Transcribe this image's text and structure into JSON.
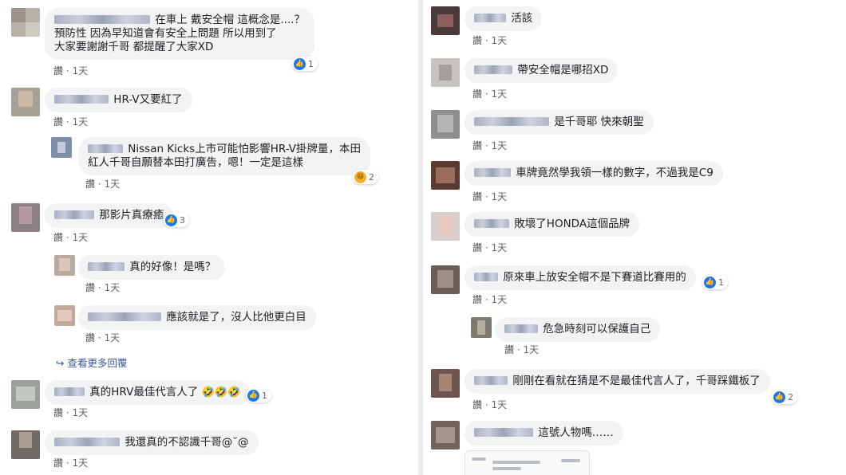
{
  "like_label": "讚",
  "dot": "·",
  "time": "1天",
  "left": [
    {
      "text1": "在車上 戴安全帽 這概念是....？",
      "text2": "預防性 因為早知道會有安全上問題 所以用到了",
      "text3": "大家要謝謝千哥 都提醒了大家XD",
      "reaction_count": "1"
    },
    {
      "text1": "HR-V又要紅了"
    },
    {
      "text1": "Nissan Kicks上市可能怕影響HR-V掛牌量，本田",
      "text2": "紅人千哥自願替本田打廣告，嗯！一定是這樣",
      "reaction_count": "2"
    },
    {
      "text1": "那影片真療癒",
      "reaction_count": "3"
    },
    {
      "text1": "真的好像！是嗎？"
    },
    {
      "text1": "應該就是了，沒人比他更白目"
    },
    {
      "text1": "真的HRV最佳代言人了",
      "reaction_count": "1"
    },
    {
      "text1": "我還真的不認識千哥@˘@"
    }
  ],
  "more_replies": "查看更多回覆",
  "right": [
    {
      "text1": "活該"
    },
    {
      "text1": "帶安全帽是哪招XD"
    },
    {
      "text1": "是千哥耶 快來朝聖"
    },
    {
      "text1": "車牌竟然學我領一樣的數字，不過我是C9"
    },
    {
      "text1": "敗壞了HONDA這個品牌"
    },
    {
      "text1": "原來車上放安全帽不是下賽道比賽用的",
      "reaction_count": "1"
    },
    {
      "text1": "危急時刻可以保護自己"
    },
    {
      "text1": "剛剛在看就在猜是不是最佳代言人了，千哥踩鐵板了",
      "reaction_count": "2"
    },
    {
      "text1": "這號人物嗎……"
    }
  ],
  "icons": {
    "like": "thumbs-up-icon",
    "haha": "haha-emoji-icon",
    "reply_arrow": "reply-arrow-icon"
  },
  "colors": {
    "bubble": "#f2f3f5",
    "link": "#385898",
    "like_blue": "#1877f2",
    "meta": "#606770"
  }
}
